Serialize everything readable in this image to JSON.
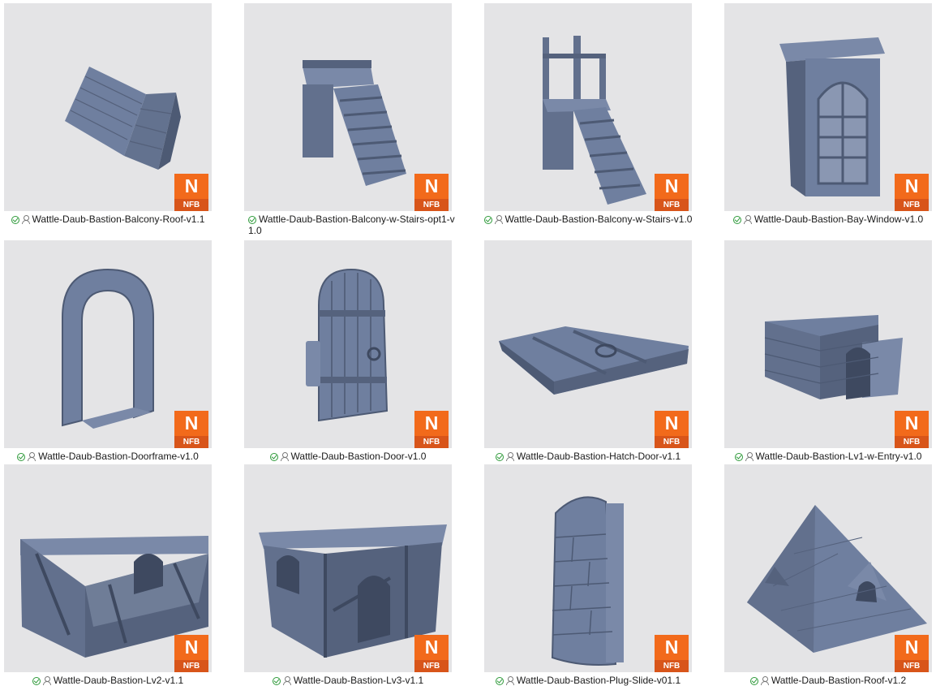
{
  "badge": {
    "letter": "N",
    "sub": "NFB"
  },
  "items": [
    {
      "label": "Wattle-Daub-Bastion-Balcony-Roof-v1.1",
      "icon": "roof-panels"
    },
    {
      "label": "Wattle-Daub-Bastion-Balcony-w-Stairs-opt1-v1.0",
      "icon": "balcony-stairs"
    },
    {
      "label": "Wattle-Daub-Bastion-Balcony-w-Stairs-v1.0",
      "icon": "balcony-stairs-posts"
    },
    {
      "label": "Wattle-Daub-Bastion-Bay-Window-v1.0",
      "icon": "bay-window"
    },
    {
      "label": "Wattle-Daub-Bastion-Doorframe-v1.0",
      "icon": "doorframe"
    },
    {
      "label": "Wattle-Daub-Bastion-Door-v1.0",
      "icon": "door"
    },
    {
      "label": "Wattle-Daub-Bastion-Hatch-Door-v1.1",
      "icon": "hatch-door"
    },
    {
      "label": "Wattle-Daub-Bastion-Lv1-w-Entry-v1.0",
      "icon": "level1-entry"
    },
    {
      "label": "Wattle-Daub-Bastion-Lv2-v1.1",
      "icon": "level2"
    },
    {
      "label": "Wattle-Daub-Bastion-Lv3-v1.1",
      "icon": "level3"
    },
    {
      "label": "Wattle-Daub-Bastion-Plug-Slide-v01.1",
      "icon": "plug-slide"
    },
    {
      "label": "Wattle-Daub-Bastion-Roof-v1.2",
      "icon": "roof-pyramid"
    }
  ],
  "colors": {
    "badge_orange": "#f26a1b",
    "badge_dark": "#d8551a",
    "model": "#6f7f9f",
    "model_dark": "#4d5a74",
    "thumb_bg": "#e4e4e6",
    "status_green": "#2e9a3a"
  }
}
